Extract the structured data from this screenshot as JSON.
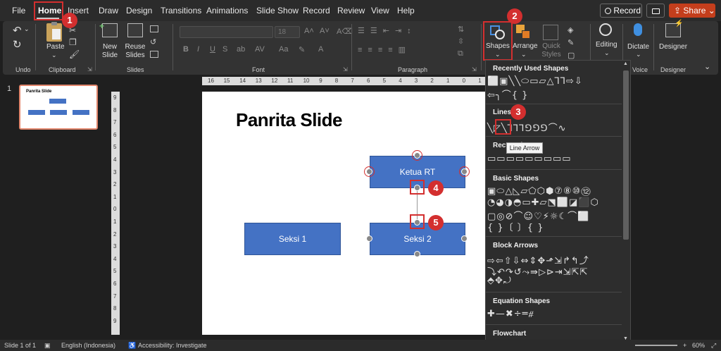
{
  "menu": {
    "tabs": [
      "File",
      "Home",
      "Insert",
      "Draw",
      "Design",
      "Transitions",
      "Animations",
      "Slide Show",
      "Record",
      "Review",
      "View",
      "Help"
    ],
    "record_label": "Record",
    "share_label": "Share"
  },
  "ribbon": {
    "undo_group": "Undo",
    "clipboard": {
      "paste": "Paste",
      "group": "Clipboard"
    },
    "slides": {
      "new_slide": "New Slide",
      "reuse_slides": "Reuse Slides",
      "group": "Slides"
    },
    "font": {
      "size": "18",
      "group": "Font"
    },
    "paragraph": {
      "group": "Paragraph"
    },
    "drawing": {
      "shapes": "Shapes",
      "arrange": "Arrange",
      "quick_styles": "Quick Styles"
    },
    "editing": "Editing",
    "dictate": "Dictate",
    "voice_group": "Voice",
    "designer": "Designer",
    "designer_group": "Designer"
  },
  "annotations": [
    "1",
    "2",
    "3",
    "4",
    "5"
  ],
  "thumbnail": {
    "number": "1",
    "title": "Panrita Slide"
  },
  "ruler": {
    "h": [
      "16",
      "15",
      "14",
      "13",
      "12",
      "11",
      "10",
      "9",
      "8",
      "7",
      "6",
      "5",
      "4",
      "3",
      "2",
      "1",
      "0",
      "1",
      "2",
      "3",
      "4",
      "5",
      "6",
      "7",
      "8",
      "9"
    ],
    "v": [
      "9",
      "8",
      "7",
      "6",
      "5",
      "4",
      "3",
      "2",
      "1",
      "0",
      "1",
      "2",
      "3",
      "4",
      "5",
      "6",
      "7",
      "8",
      "9"
    ]
  },
  "slide": {
    "title": "Panrita Slide",
    "boxes": {
      "ketua": "Ketua RT",
      "seksi1": "Seksi 1",
      "seksi2": "Seksi 2"
    }
  },
  "shapes_panel": {
    "recently_used": "Recently Used Shapes",
    "lines": "Lines",
    "rectangles": "Rectangles",
    "basic_shapes": "Basic Shapes",
    "block_arrows": "Block Arrows",
    "equation_shapes": "Equation Shapes",
    "flowchart": "Flowchart",
    "tooltip": "Line Arrow",
    "rows": {
      "recent1": "⬜▣╲╲⬭▭▱△⅂⅂⇨⇩",
      "recent2": "⇦╮⌒{ }",
      "lines": "╲◸╲⅂⅂⅂⅁⅁⅁⌒∿",
      "rects": "▭▭▭▭▭▭▭▭▭",
      "basic1": "▣⬭△◺▱⬠⬡⬢⑦⑧⑩⑫",
      "basic2": "◔◕◑◓▭✚▱⬔⬜◪⬛⬡",
      "basic3": "▢◎⊘⌒☺♡⚡☼☾⌒⬜",
      "basic4": "{ }〔 〕{ }",
      "arrows1": "⇨⇦⇧⇩⇔⇕✥⬏⇲↱↰⤴",
      "arrows2": "⤵↶↷↺⤳⇛▷⊳⇥⇲⇱⇱",
      "arrows3": "⬘✥⤾",
      "equation": "✚—✖÷═⧣",
      "flow": "▭▭◇▱▭▭▭▭▭▭▭▭"
    }
  },
  "status": {
    "slide": "Slide 1 of 1",
    "language": "English (Indonesia)",
    "accessibility": "Accessibility: Investigate",
    "zoom": "60%"
  }
}
